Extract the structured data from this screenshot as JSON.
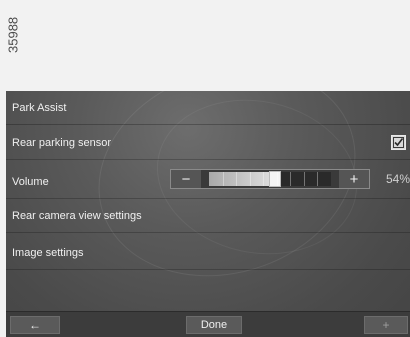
{
  "reference_id": "35988",
  "screen": {
    "title": "Park Assist",
    "rows": [
      {
        "label": "Rear parking sensor",
        "checked": true
      },
      {
        "label": "Volume",
        "percent_text": "54%",
        "level": 0.54
      },
      {
        "label": "Rear camera view settings"
      },
      {
        "label": "Image settings"
      }
    ],
    "slider": {
      "minus_symbol": "−",
      "plus_symbol": "+"
    },
    "bottom_bar": {
      "back_symbol": "←",
      "done_label": "Done",
      "add_symbol": "+"
    }
  },
  "icons": {
    "back": "arrow-left-icon",
    "add": "plus-icon",
    "check": "checkbox-checked-icon"
  },
  "colors": {
    "background": "#f2f2f2",
    "screen": "#5a5a5a",
    "text": "#f0f0f0"
  }
}
